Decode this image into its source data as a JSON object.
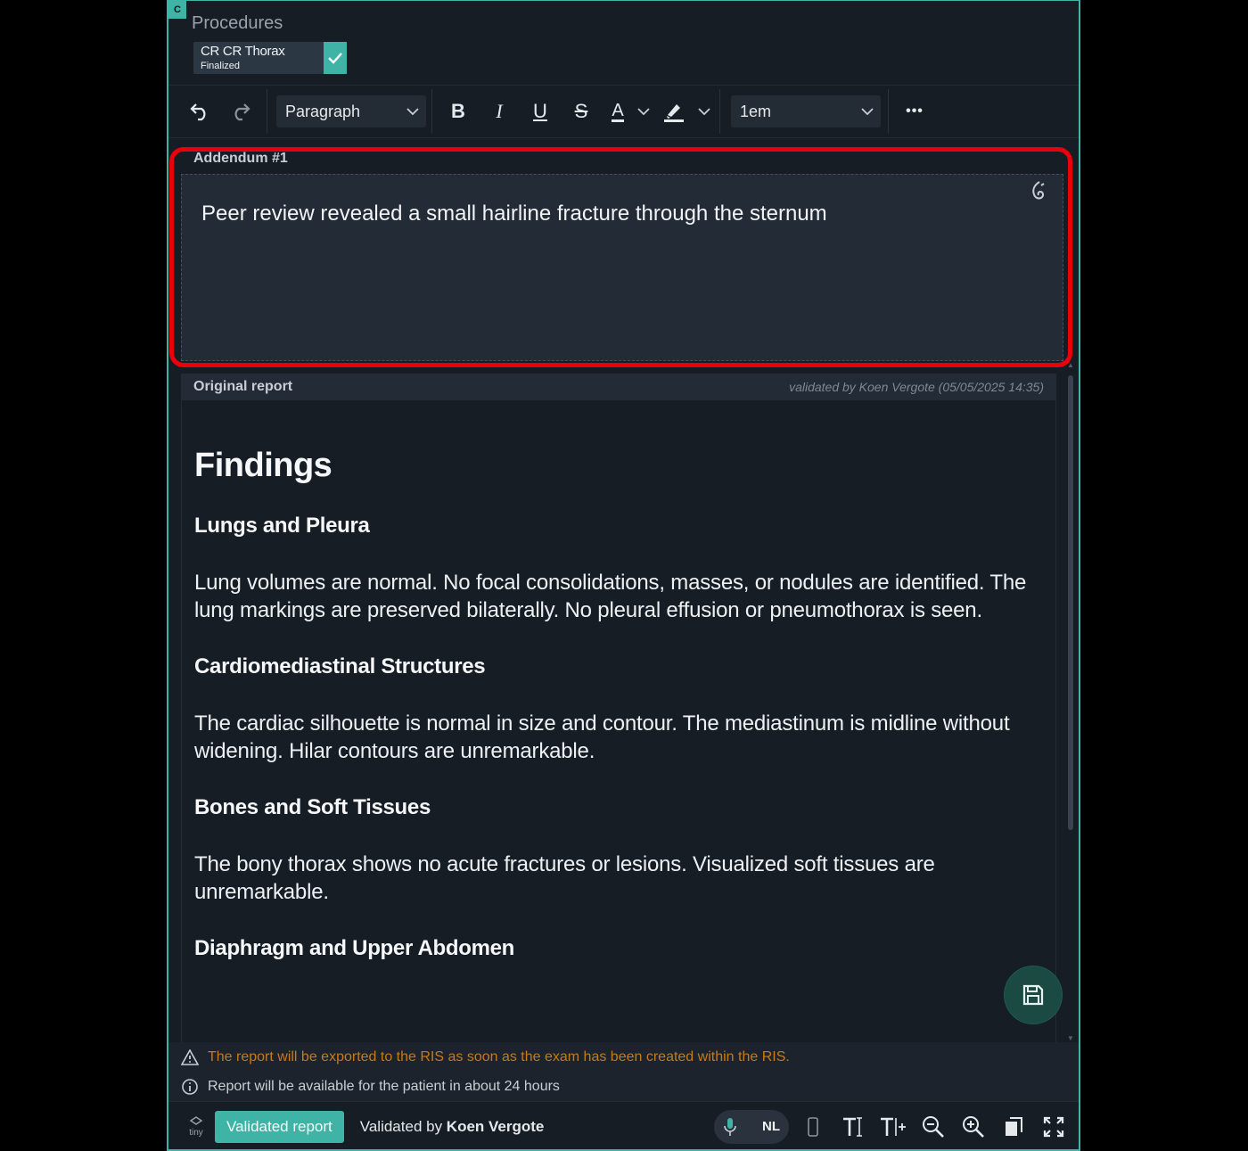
{
  "header": {
    "corner_badge": "C",
    "title": "Procedures",
    "procedure": {
      "name": "CR CR Thorax",
      "status": "Finalized"
    }
  },
  "toolbar": {
    "block_format": "Paragraph",
    "font_size": "1em",
    "bold_glyph": "B",
    "italic_glyph": "I",
    "underline_glyph": "U",
    "strike_glyph": "S",
    "text_color_glyph": "A",
    "more_glyph": "•••"
  },
  "addendum": {
    "label": "Addendum #1",
    "text": "Peer review revealed a small hairline fracture through the sternum"
  },
  "report": {
    "label": "Original report",
    "validated_note": "validated by Koen Vergote (05/05/2025 14:35)",
    "heading": "Findings",
    "sections": [
      {
        "title": "Lungs and Pleura",
        "body": "Lung volumes are normal. No focal consolidations, masses, or nodules are identified. The lung markings are preserved bilaterally. No pleural effusion or pneumothorax is seen."
      },
      {
        "title": "Cardiomediastinal Structures",
        "body": "The cardiac silhouette is normal in size and contour. The mediastinum is midline without widening. Hilar contours are unremarkable."
      },
      {
        "title": "Bones and Soft Tissues",
        "body": "The bony thorax shows no acute fractures or lesions. Visualized soft tissues are unremarkable."
      },
      {
        "title": "Diaphragm and Upper Abdomen",
        "body": ""
      }
    ]
  },
  "notices": {
    "export": "The report will be exported to the RIS as soon as the exam has been created within the RIS.",
    "patient": "Report will be available for the patient in about 24 hours"
  },
  "statusbar": {
    "logo_text": "tiny",
    "validated_button": "Validated report",
    "validated_by_prefix": "Validated by",
    "validated_by_name": "Koen Vergote",
    "language": "NL"
  },
  "colors": {
    "accent": "#3fb3a6",
    "highlight": "#e8000b",
    "warning": "#c47b1c",
    "background": "#171d25"
  },
  "icons": [
    "undo-icon",
    "redo-icon",
    "chevron-down-icon",
    "highlighter-icon",
    "dragon-icon",
    "save-icon",
    "warning-icon",
    "info-icon",
    "microphone-icon",
    "mobile-icon",
    "text-size-icon",
    "text-size-increase-icon",
    "zoom-out-icon",
    "zoom-in-icon",
    "copy-icon",
    "fullscreen-icon",
    "check-icon"
  ]
}
